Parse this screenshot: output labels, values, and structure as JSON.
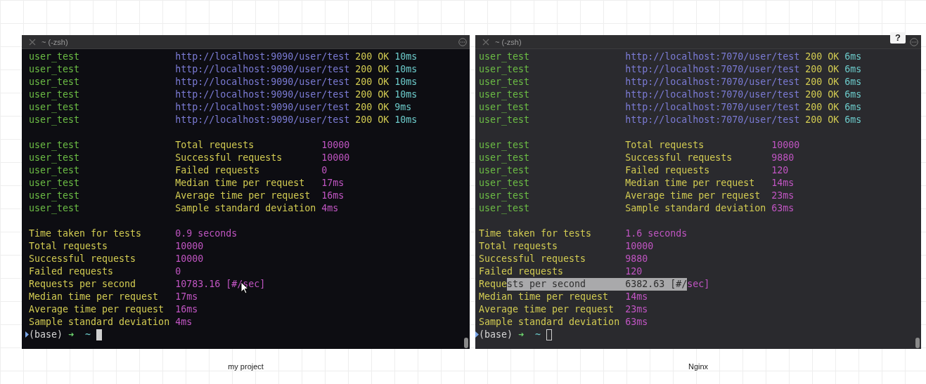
{
  "panes": [
    {
      "title": "~ (-zsh)",
      "caption": "my project",
      "focused": true,
      "mouse_pointer": true,
      "requests": [
        {
          "name": "user_test",
          "url": "http://localhost:9090/user/test",
          "status": "200 OK",
          "time": "10ms"
        },
        {
          "name": "user_test",
          "url": "http://localhost:9090/user/test",
          "status": "200 OK",
          "time": "10ms"
        },
        {
          "name": "user_test",
          "url": "http://localhost:9090/user/test",
          "status": "200 OK",
          "time": "10ms"
        },
        {
          "name": "user_test",
          "url": "http://localhost:9090/user/test",
          "status": "200 OK",
          "time": "10ms"
        },
        {
          "name": "user_test",
          "url": "http://localhost:9090/user/test",
          "status": "200 OK",
          "time": "9ms"
        },
        {
          "name": "user_test",
          "url": "http://localhost:9090/user/test",
          "status": "200 OK",
          "time": "10ms"
        }
      ],
      "summary": [
        {
          "name": "user_test",
          "label": "Total requests",
          "value": "10000"
        },
        {
          "name": "user_test",
          "label": "Successful requests",
          "value": "10000"
        },
        {
          "name": "user_test",
          "label": "Failed requests",
          "value": "0"
        },
        {
          "name": "user_test",
          "label": "Median time per request",
          "value": "17ms"
        },
        {
          "name": "user_test",
          "label": "Average time per request",
          "value": "16ms"
        },
        {
          "name": "user_test",
          "label": "Sample standard deviation",
          "value": "4ms"
        }
      ],
      "totals": [
        {
          "label": [
            {
              "text": "Time taken for tests",
              "selected": false
            }
          ],
          "value": [
            {
              "text": "0.9 seconds",
              "selected": false
            }
          ]
        },
        {
          "label": [
            {
              "text": "Total requests",
              "selected": false
            }
          ],
          "value": [
            {
              "text": "10000",
              "selected": false
            }
          ]
        },
        {
          "label": [
            {
              "text": "Successful requests",
              "selected": false
            }
          ],
          "value": [
            {
              "text": "10000",
              "selected": false
            }
          ]
        },
        {
          "label": [
            {
              "text": "Failed requests",
              "selected": false
            }
          ],
          "value": [
            {
              "text": "0",
              "selected": false
            }
          ]
        },
        {
          "label": [
            {
              "text": "Requests per second",
              "selected": false
            }
          ],
          "value": [
            {
              "text": "10783.16 [#/sec]",
              "selected": false
            }
          ]
        },
        {
          "label": [
            {
              "text": "Median time per request",
              "selected": false
            }
          ],
          "value": [
            {
              "text": "17ms",
              "selected": false
            }
          ]
        },
        {
          "label": [
            {
              "text": "Average time per request",
              "selected": false
            }
          ],
          "value": [
            {
              "text": "16ms",
              "selected": false
            }
          ]
        },
        {
          "label": [
            {
              "text": "Sample standard deviation",
              "selected": false
            }
          ],
          "value": [
            {
              "text": "4ms",
              "selected": false
            }
          ]
        }
      ],
      "prompt": {
        "env": "(base)",
        "arrow": "➜",
        "dir": "~"
      }
    },
    {
      "title": "~ (-zsh)",
      "caption": "Nginx",
      "focused": false,
      "help_button": "?",
      "requests": [
        {
          "name": "user_test",
          "url": "http://localhost:7070/user/test",
          "status": "200 OK",
          "time": "6ms"
        },
        {
          "name": "user_test",
          "url": "http://localhost:7070/user/test",
          "status": "200 OK",
          "time": "6ms"
        },
        {
          "name": "user_test",
          "url": "http://localhost:7070/user/test",
          "status": "200 OK",
          "time": "6ms"
        },
        {
          "name": "user_test",
          "url": "http://localhost:7070/user/test",
          "status": "200 OK",
          "time": "6ms"
        },
        {
          "name": "user_test",
          "url": "http://localhost:7070/user/test",
          "status": "200 OK",
          "time": "6ms"
        },
        {
          "name": "user_test",
          "url": "http://localhost:7070/user/test",
          "status": "200 OK",
          "time": "6ms"
        }
      ],
      "summary": [
        {
          "name": "user_test",
          "label": "Total requests",
          "value": "10000"
        },
        {
          "name": "user_test",
          "label": "Successful requests",
          "value": "9880"
        },
        {
          "name": "user_test",
          "label": "Failed requests",
          "value": "120"
        },
        {
          "name": "user_test",
          "label": "Median time per request",
          "value": "14ms"
        },
        {
          "name": "user_test",
          "label": "Average time per request",
          "value": "23ms"
        },
        {
          "name": "user_test",
          "label": "Sample standard deviation",
          "value": "63ms"
        }
      ],
      "totals": [
        {
          "label": [
            {
              "text": "Time taken for tests",
              "selected": false
            }
          ],
          "value": [
            {
              "text": "1.6 seconds",
              "selected": false
            }
          ]
        },
        {
          "label": [
            {
              "text": "Total requests",
              "selected": false
            }
          ],
          "value": [
            {
              "text": "10000",
              "selected": false
            }
          ]
        },
        {
          "label": [
            {
              "text": "Successful requests",
              "selected": false
            }
          ],
          "value": [
            {
              "text": "9880",
              "selected": false
            }
          ]
        },
        {
          "label": [
            {
              "text": "Failed requests",
              "selected": false
            }
          ],
          "value": [
            {
              "text": "120",
              "selected": false
            }
          ]
        },
        {
          "label": [
            {
              "text": "Reque",
              "selected": false
            },
            {
              "text": "sts per second",
              "selected": true
            }
          ],
          "value": [
            {
              "text": "6382.63 [#/",
              "selected": true
            },
            {
              "text": "sec]",
              "selected": false
            }
          ]
        },
        {
          "label": [
            {
              "text": "Median time per request",
              "selected": false
            }
          ],
          "value": [
            {
              "text": "14ms",
              "selected": false
            }
          ]
        },
        {
          "label": [
            {
              "text": "Average time per request",
              "selected": false
            }
          ],
          "value": [
            {
              "text": "23ms",
              "selected": false
            }
          ]
        },
        {
          "label": [
            {
              "text": "Sample standard deviation",
              "selected": false
            }
          ],
          "value": [
            {
              "text": "63ms",
              "selected": false
            }
          ]
        }
      ],
      "prompt": {
        "env": "(base)",
        "arrow": "➜",
        "dir": "~"
      }
    }
  ]
}
